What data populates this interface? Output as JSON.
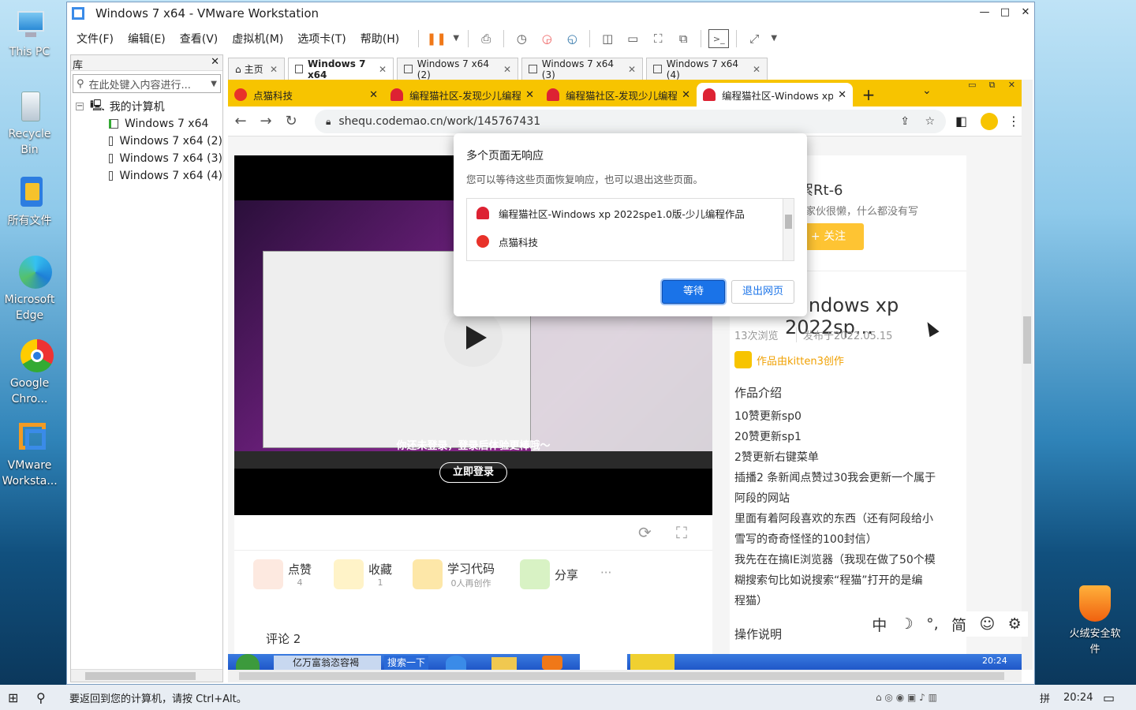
{
  "desktop": {
    "icons": [
      {
        "label": "This PC",
        "icon": "monitor-icon"
      },
      {
        "label": "Recycle Bin",
        "icon": "recycle-bin-icon"
      },
      {
        "label": "所有文件",
        "icon": "folder-icon"
      },
      {
        "label": "Microsoft Edge",
        "icon": "edge-icon"
      },
      {
        "label": "Google Chro...",
        "icon": "chrome-dev-icon"
      },
      {
        "label": "VMware Worksta...",
        "icon": "vmware-icon"
      }
    ],
    "right_icon": {
      "label": "火绒安全软件",
      "icon": "huorong-icon"
    }
  },
  "vmware": {
    "title": "Windows 7 x64 - VMware Workstation",
    "menu": [
      "文件(F)",
      "编辑(E)",
      "查看(V)",
      "虚拟机(M)",
      "选项卡(T)",
      "帮助(H)"
    ],
    "library": {
      "title": "库",
      "search_placeholder": "在此处键入内容进行...",
      "root": "我的计算机",
      "items": [
        "Windows 7 x64",
        "Windows 7 x64 (2)",
        "Windows 7 x64 (3)",
        "Windows 7 x64 (4)"
      ]
    },
    "tabs": [
      {
        "label": "主页",
        "active": false
      },
      {
        "label": "Windows 7 x64",
        "active": true
      },
      {
        "label": "Windows 7 x64 (2)",
        "active": false
      },
      {
        "label": "Windows 7 x64 (3)",
        "active": false
      },
      {
        "label": "Windows 7 x64 (4)",
        "active": false
      }
    ],
    "status": "要返回到您的计算机，请按 Ctrl+Alt。"
  },
  "chrome": {
    "tabs": [
      {
        "label": "点猫科技",
        "active": false
      },
      {
        "label": "编程猫社区-发现少儿编程",
        "active": false
      },
      {
        "label": "编程猫社区-发现少儿编程",
        "active": false
      },
      {
        "label": "编程猫社区-Windows xp",
        "active": true
      }
    ],
    "url": "shequ.codemao.cn/work/145767431",
    "accent": "#f7c400"
  },
  "page": {
    "login_tip": "你还未登录，登录后体验更棒哦～",
    "login_button": "立即登录",
    "actions": [
      {
        "label": "点赞",
        "count": "4"
      },
      {
        "label": "收藏",
        "count": "1"
      },
      {
        "label": "学习代码",
        "count": "0人再创作"
      },
      {
        "label": "分享",
        "count": ""
      }
    ],
    "more": "···",
    "comments_partial": "评论 2",
    "author_name": "花絮Rt-6",
    "author_bio": "这个家伙很懒，什么都没有写",
    "follow_button": "+ 关注",
    "work_title": "Windows xp 2022sp...",
    "views": "13次浏览",
    "published": "发布于2022.05.15",
    "made_by": "作品由kitten3创作",
    "intro_heading": "作品介绍",
    "intro_lines": [
      "10赞更新sp0",
      "20赞更新sp1",
      "2赞更新右键菜单",
      "插播2 条新闻点赞过30我会更新一个属于",
      "阿段的网站",
      "里面有着阿段喜欢的东西（还有阿段给小",
      "雪写的奇奇怪怪的100封信）",
      "我先在在搞IE浏览器（我现在做了50个模",
      "糊搜索句比如说搜索“程猫”打开的是编",
      "程猫）"
    ],
    "ops_heading": "操作说明"
  },
  "dialog": {
    "title": "多个页面无响应",
    "message": "您可以等待这些页面恢复响应，也可以退出这些页面。",
    "pages": [
      "编程猫社区-Windows xp 2022spe1.0版-少儿编程作品",
      "点猫科技"
    ],
    "wait_button": "等待",
    "exit_button": "退出网页"
  },
  "guest_taskbar": {
    "items": [
      "亿万富翁恣容褐",
      "搜索一下"
    ],
    "clock": "20:24"
  },
  "ime": {
    "items": [
      "中",
      "☽",
      "°,",
      "简",
      "☺",
      "⚙"
    ]
  },
  "host_taskbar": {
    "clock": "20:24",
    "layout": "拼"
  }
}
